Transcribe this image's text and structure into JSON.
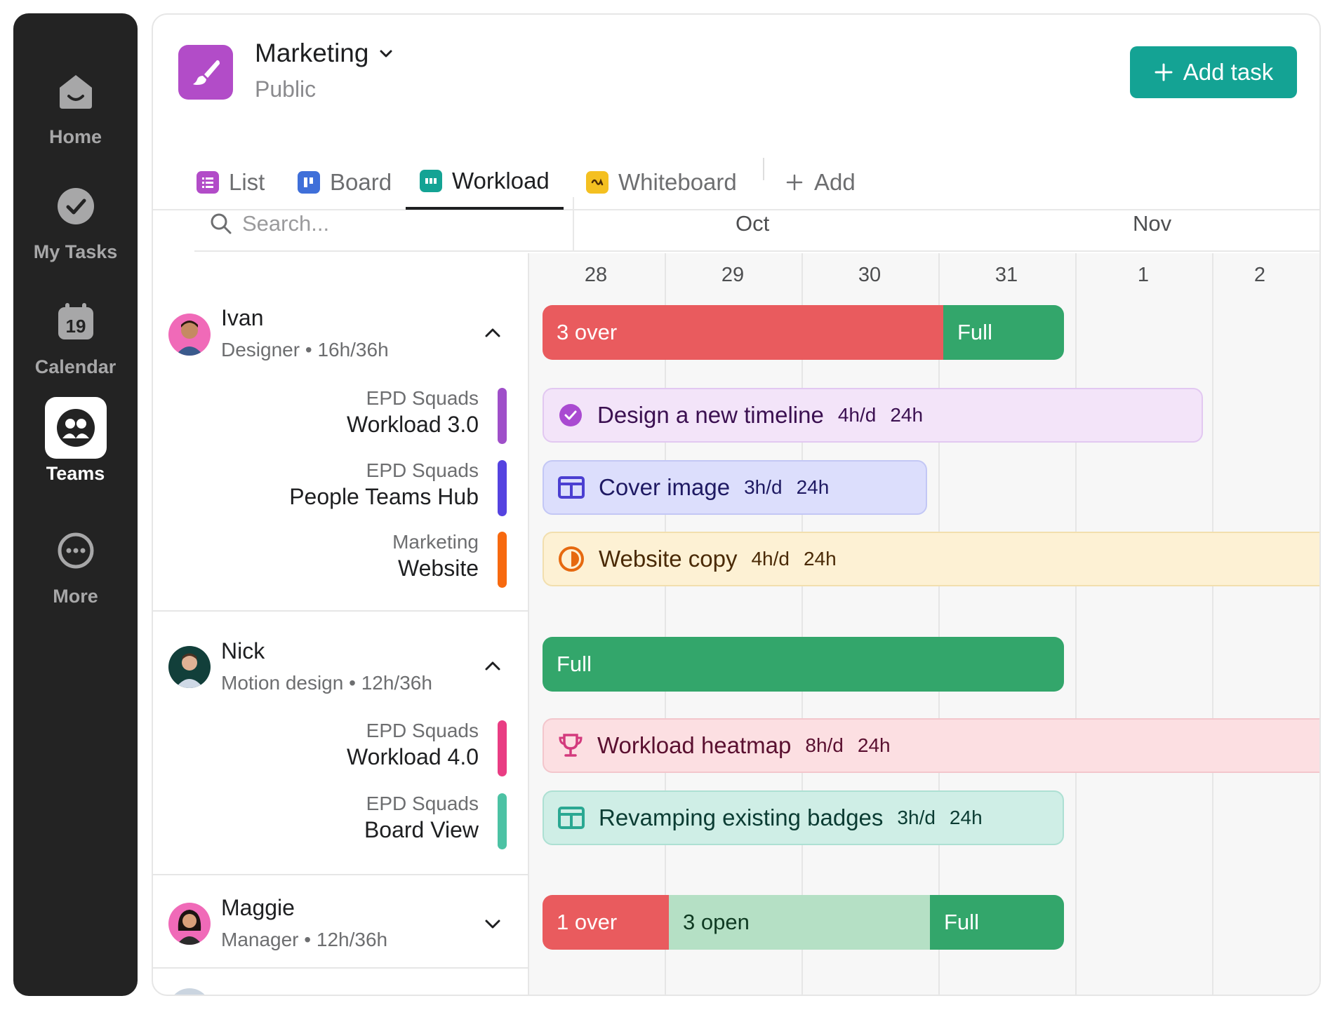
{
  "sidebar": {
    "items": [
      {
        "label": "Home",
        "icon": "home-icon"
      },
      {
        "label": "My Tasks",
        "icon": "check-circle-icon"
      },
      {
        "label": "Calendar",
        "icon": "calendar-icon",
        "day": "19"
      },
      {
        "label": "Teams",
        "icon": "teams-icon",
        "active": true
      },
      {
        "label": "More",
        "icon": "more-icon"
      }
    ]
  },
  "project": {
    "name": "Marketing",
    "visibility": "Public",
    "color": "#b24cc8"
  },
  "header": {
    "add_task_label": "Add task"
  },
  "tabs": [
    {
      "label": "List",
      "color": "#b24cc8"
    },
    {
      "label": "Board",
      "color": "#3f6fd9"
    },
    {
      "label": "Workload",
      "color": "#14a394",
      "active": true
    },
    {
      "label": "Whiteboard",
      "color": "#f4c021"
    },
    {
      "label": "Add"
    }
  ],
  "search": {
    "placeholder": "Search..."
  },
  "timeline": {
    "months": [
      "Oct",
      "Nov"
    ],
    "days": [
      "28",
      "29",
      "30",
      "31",
      "1",
      "2"
    ]
  },
  "people": [
    {
      "name": "Ivan",
      "role": "Designer",
      "hours": "16h/36h",
      "expanded": true,
      "capacity": [
        {
          "label": "3 over",
          "status": "over"
        },
        {
          "label": "Full",
          "status": "full"
        }
      ],
      "projects": [
        {
          "team": "EPD Squads",
          "name": "Workload 3.0",
          "color": "#9f4fc9"
        },
        {
          "team": "EPD Squads",
          "name": "People Teams Hub",
          "color": "#5543e0"
        },
        {
          "team": "Marketing",
          "name": "Website",
          "color": "#f7690f"
        }
      ],
      "tasks": [
        {
          "title": "Design a new timeline",
          "rate": "4h/d",
          "total": "24h",
          "icon": "check-circle-icon",
          "bg": "#f3e4f9",
          "border": "#e2c8f1",
          "accent": "#a94ad1",
          "text": "#3b1051"
        },
        {
          "title": "Cover image",
          "rate": "3h/d",
          "total": "24h",
          "icon": "layout-icon",
          "bg": "#dcdefc",
          "border": "#c3c7f5",
          "accent": "#4b3fd1",
          "text": "#1f1a63"
        },
        {
          "title": "Website copy",
          "rate": "4h/d",
          "total": "24h",
          "icon": "progress-icon",
          "bg": "#fdf1d4",
          "border": "#f2dfae",
          "accent": "#e6690f",
          "text": "#4a2a06"
        }
      ]
    },
    {
      "name": "Nick",
      "role": "Motion design",
      "hours": "12h/36h",
      "expanded": true,
      "capacity": [
        {
          "label": "Full",
          "status": "full"
        }
      ],
      "projects": [
        {
          "team": "EPD Squads",
          "name": "Workload 4.0",
          "color": "#e93d83"
        },
        {
          "team": "EPD Squads",
          "name": "Board View",
          "color": "#4cc2a4"
        }
      ],
      "tasks": [
        {
          "title": "Workload heatmap",
          "rate": "8h/d",
          "total": "24h",
          "icon": "trophy-icon",
          "bg": "#fcdfe2",
          "border": "#f3c6cc",
          "accent": "#d33a7d",
          "text": "#5a1030"
        },
        {
          "title": "Revamping existing badges",
          "rate": "3h/d",
          "total": "24h",
          "icon": "layout-icon",
          "bg": "#cfeee6",
          "border": "#ade0d3",
          "accent": "#2aa892",
          "text": "#0b3c33"
        }
      ]
    },
    {
      "name": "Maggie",
      "role": "Manager",
      "hours": "12h/36h",
      "expanded": false,
      "capacity": [
        {
          "label": "1 over",
          "status": "over"
        },
        {
          "label": "3 open",
          "status": "open"
        },
        {
          "label": "Full",
          "status": "full"
        }
      ],
      "projects": [],
      "tasks": []
    }
  ],
  "status_colors": {
    "over": "#e95b5e",
    "full": "#33a66b",
    "open": "#b5e0c5"
  }
}
